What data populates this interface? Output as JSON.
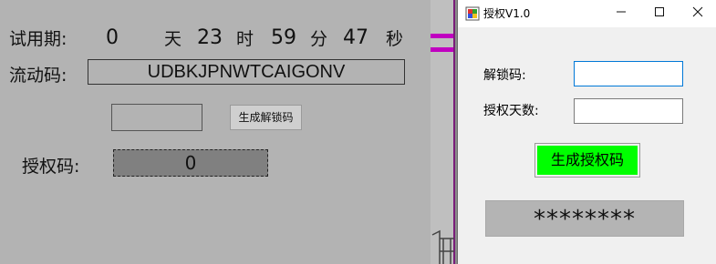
{
  "background_window": {
    "trial_label": "试用期:",
    "trial_days": "0",
    "day_unit": "天",
    "trial_hours": "23",
    "hour_unit": "时",
    "trial_minutes": "59",
    "minute_unit": "分",
    "trial_seconds": "47",
    "second_unit": "秒",
    "flow_code_label": "流动码:",
    "flow_code_value": "UDBKJPNWTCAIGONV",
    "unlock_input_value": "",
    "generate_unlock_button": "生成解锁码",
    "auth_code_label": "授权码:",
    "auth_code_value": "0"
  },
  "dialog": {
    "title": "授权V1.0",
    "controls": {
      "minimize": "—",
      "maximize": "☐",
      "close": "✕"
    },
    "unlock_code_label": "解锁码:",
    "unlock_code_value": "",
    "auth_days_label": "授权天数:",
    "auth_days_value": "",
    "generate_button": "生成授权码",
    "result_text": "********"
  },
  "colors": {
    "generate_button_bg": "#00ff00",
    "focus_border": "#0078d7",
    "background_window_bg": "#b3b3b3"
  }
}
